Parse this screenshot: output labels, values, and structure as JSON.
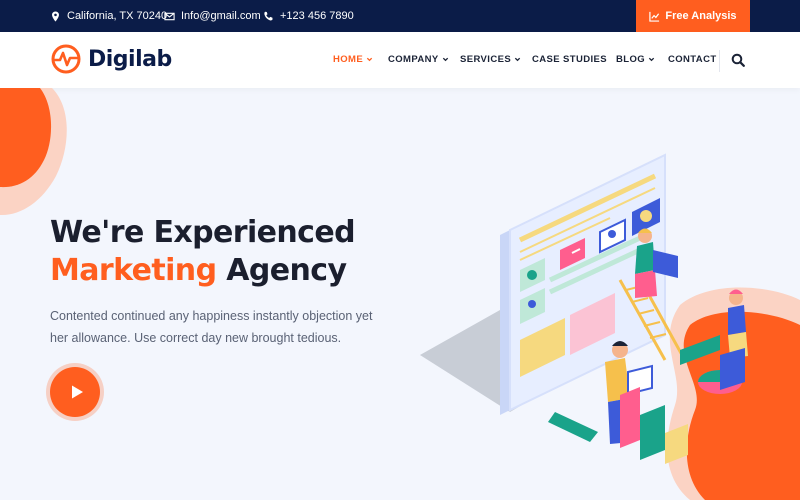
{
  "topbar": {
    "location": "California, TX 70240",
    "email": "Info@gmail.com",
    "phone": "+123 456 7890",
    "cta_label": "Free Analysis"
  },
  "brand": {
    "name": "Digilab"
  },
  "nav": {
    "items": [
      {
        "label": "HOME",
        "active": true,
        "dropdown": true
      },
      {
        "label": "COMPANY",
        "active": false,
        "dropdown": true
      },
      {
        "label": "SERVICES",
        "active": false,
        "dropdown": true
      },
      {
        "label": "CASE STUDIES",
        "active": false,
        "dropdown": false
      },
      {
        "label": "BLOG",
        "active": false,
        "dropdown": true
      },
      {
        "label": "CONTACT",
        "active": false,
        "dropdown": false
      }
    ]
  },
  "hero": {
    "title_line1": "We're Experienced",
    "title_accent": "Marketing",
    "title_rest": " Agency",
    "description": "Contented continued any happiness instantly objection yet her allowance. Use correct day new brought tedious."
  },
  "colors": {
    "accent": "#ff5e1f",
    "navy": "#0b1c48",
    "background": "#f3f6fd"
  }
}
